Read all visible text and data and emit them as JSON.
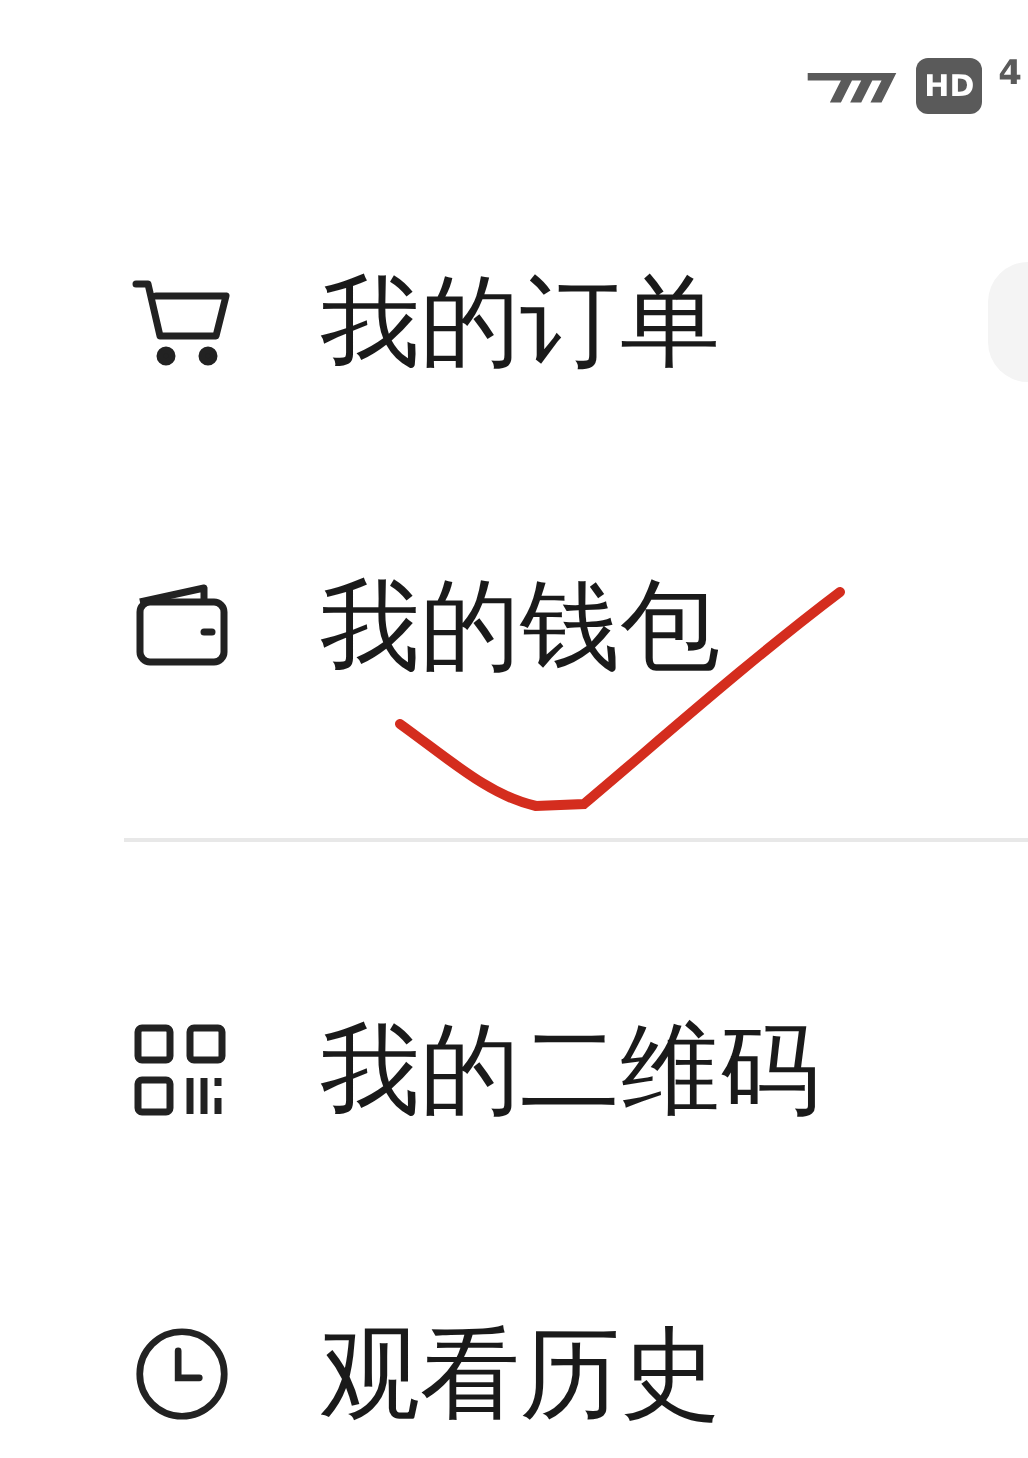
{
  "status_bar": {
    "hd_badge": "HD",
    "network": "4"
  },
  "menu_groups": [
    {
      "items": [
        {
          "label": "我的订单",
          "kind": "cart"
        },
        {
          "label": "我的钱包",
          "kind": "wallet"
        }
      ]
    },
    {
      "items": [
        {
          "label": "我的二维码",
          "kind": "qr"
        },
        {
          "label": "观看历史",
          "kind": "clock"
        }
      ]
    }
  ]
}
